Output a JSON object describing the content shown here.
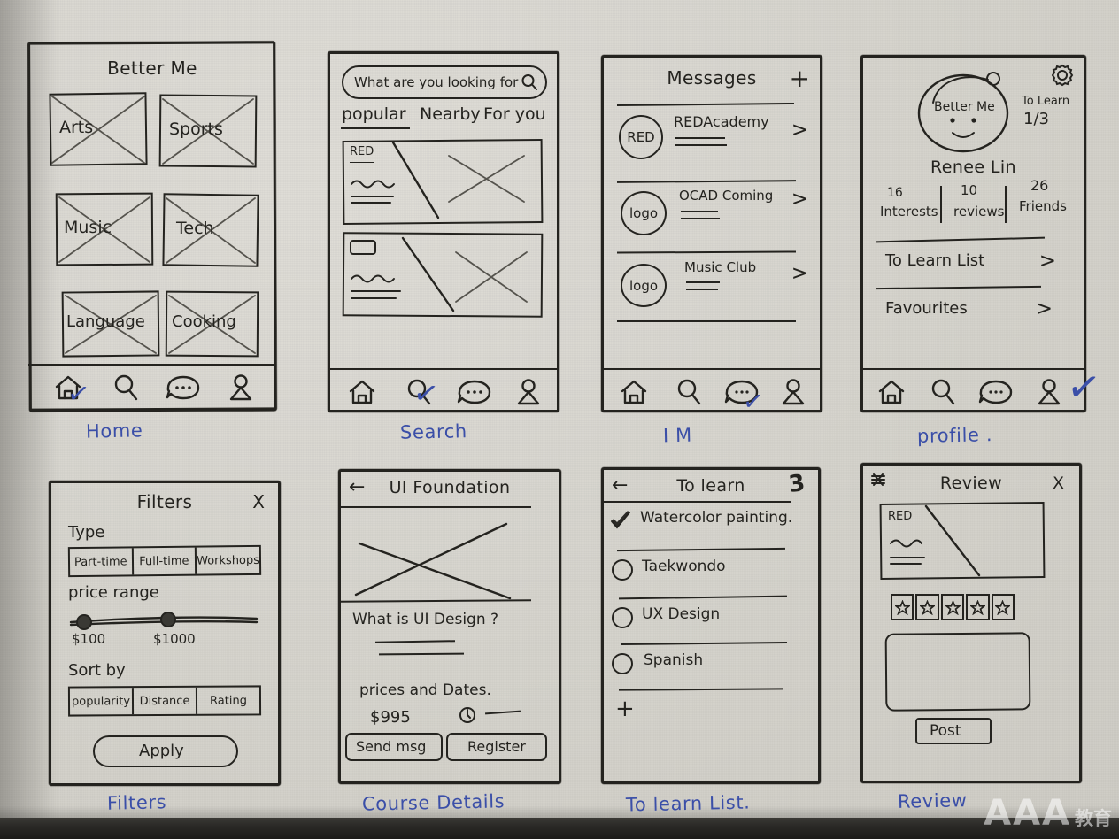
{
  "watermark": {
    "text": "AAA",
    "suffix": "教育"
  },
  "screens": [
    {
      "id": "home",
      "caption": "Home",
      "title": "Better Me",
      "categories": [
        "Arts",
        "Sports",
        "Music",
        "Tech",
        "Language",
        "Cooking"
      ],
      "tabs": [
        "home-icon",
        "search-icon",
        "chat-icon",
        "profile-icon"
      ],
      "active_tab": 0
    },
    {
      "id": "search",
      "caption": "Search",
      "search_placeholder": "What are you looking for",
      "tabs_row": [
        "popular",
        "Nearby",
        "For you"
      ],
      "active_filter": "popular",
      "card1_label": "RED",
      "tabs": [
        "home-icon",
        "search-icon",
        "chat-icon",
        "profile-icon"
      ],
      "active_tab": 1
    },
    {
      "id": "messages",
      "caption": "I M",
      "title": "Messages",
      "add_label": "+",
      "rows": [
        {
          "avatar": "RED",
          "name": "REDAcademy",
          "chevron": ">"
        },
        {
          "avatar": "logo",
          "name": "OCAD Coming",
          "chevron": ">"
        },
        {
          "avatar": "logo",
          "name": "Music Club",
          "chevron": ">"
        }
      ],
      "tabs": [
        "home-icon",
        "search-icon",
        "chat-icon",
        "profile-icon"
      ],
      "active_tab": 2
    },
    {
      "id": "profile",
      "caption": "profile .",
      "avatar_text": "Better Me",
      "gear": "gear-icon",
      "to_learn_label": "To Learn",
      "to_learn_value": "1/3",
      "user_name": "Renee Lin",
      "stats": [
        {
          "value": "16",
          "label": "Interests"
        },
        {
          "value": "10",
          "label": "reviews"
        },
        {
          "value": "26",
          "label": "Friends"
        }
      ],
      "menu": [
        {
          "label": "To Learn List",
          "chevron": ">"
        },
        {
          "label": "Favourites",
          "chevron": ">"
        }
      ],
      "tabs": [
        "home-icon",
        "search-icon",
        "chat-icon",
        "profile-icon"
      ],
      "active_tab": 3
    },
    {
      "id": "filters",
      "caption": "Filters",
      "title": "Filters",
      "close_label": "X",
      "type_label": "Type",
      "type_options": [
        "Part-time",
        "Full-time",
        "Workshops"
      ],
      "price_label": "price range",
      "price_min": "$100",
      "price_max": "$1000",
      "sort_label": "Sort by",
      "sort_options": [
        "popularity",
        "Distance",
        "Rating"
      ],
      "apply_label": "Apply"
    },
    {
      "id": "course_details",
      "caption": "Course Details",
      "back_label": "←",
      "title": "UI Foundation",
      "heading": "What is UI Design ?",
      "section_label": "prices and Dates.",
      "price": "$995",
      "clock": "clock-icon",
      "buttons": [
        "Send msg",
        "Register"
      ]
    },
    {
      "id": "to_learn_list",
      "caption": "To learn List.",
      "back_label": "←",
      "title": "To learn",
      "count_badge": "3",
      "items": [
        {
          "label": "Watercolor painting.",
          "checked": true
        },
        {
          "label": "Taekwondo",
          "checked": false
        },
        {
          "label": "UX Design",
          "checked": false
        },
        {
          "label": "Spanish",
          "checked": false
        }
      ],
      "add_label": "+"
    },
    {
      "id": "review",
      "caption": "Review",
      "title": "Review",
      "close_label": "X",
      "card_label": "RED",
      "stars": 5,
      "post_label": "Post"
    }
  ]
}
